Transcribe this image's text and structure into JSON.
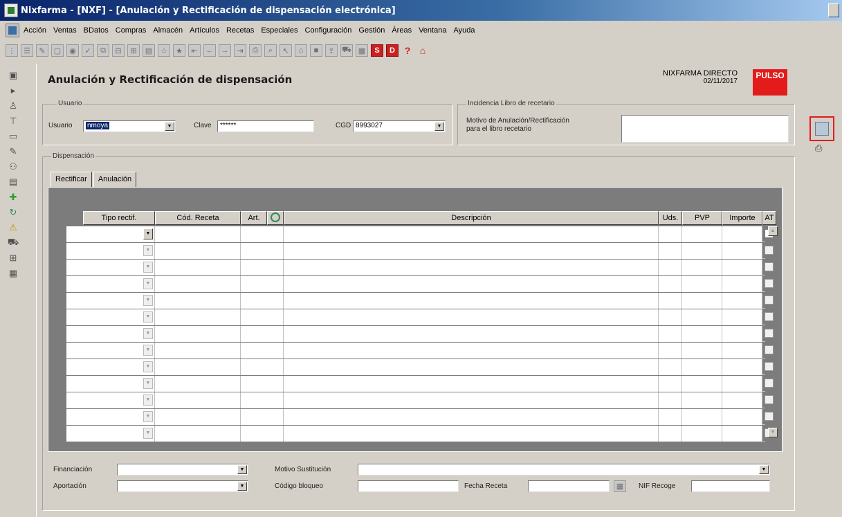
{
  "window": {
    "title": "Nixfarma - [NXF] - [Anulación y Rectificación de dispensación electrónica]"
  },
  "menu": {
    "items": [
      "Acción",
      "Ventas",
      "BDatos",
      "Compras",
      "Almacén",
      "Artículos",
      "Recetas",
      "Especiales",
      "Configuración",
      "Gestión",
      "Áreas",
      "Ventana",
      "Ayuda"
    ]
  },
  "toolbar": {
    "s_label": "S",
    "d_label": "D",
    "help_label": "?"
  },
  "header": {
    "title": "Anulación y Rectificación de dispensación",
    "brand": "NIXFARMA DIRECTO",
    "date": "02/11/2017",
    "pulso": "PULSO"
  },
  "usuario_group": {
    "label": "Usuario",
    "usuario_label": "Usuario",
    "usuario_value": "nmoya",
    "clave_label": "Clave",
    "clave_value": "******",
    "cgd_label": "CGD",
    "cgd_value": "8993027"
  },
  "incidencia_group": {
    "label": "Incidencia Libro de recetario",
    "motivo_label_1": "Motivo de Anulación/Rectificación",
    "motivo_label_2": "para el libro recetario"
  },
  "dispensacion_group": {
    "label": "Dispensación"
  },
  "tabs": [
    {
      "label": "Rectificar"
    },
    {
      "label": "Anulación"
    }
  ],
  "grid": {
    "columns": {
      "tipo": "Tipo rectif.",
      "cod_receta": "Cód. Receta",
      "art": "Art.",
      "descripcion": "Descripción",
      "uds": "Uds.",
      "pvp": "PVP",
      "importe": "Importe",
      "at": "AT"
    }
  },
  "bottom": {
    "financiacion_label": "Financiación",
    "aportacion_label": "Aportación",
    "motivo_sustitucion_label": "Motivo Sustitución",
    "codigo_bloqueo_label": "Código bloqueo",
    "fecha_receta_label": "Fecha Receta",
    "nif_recoge_label": "NIF Recoge"
  }
}
